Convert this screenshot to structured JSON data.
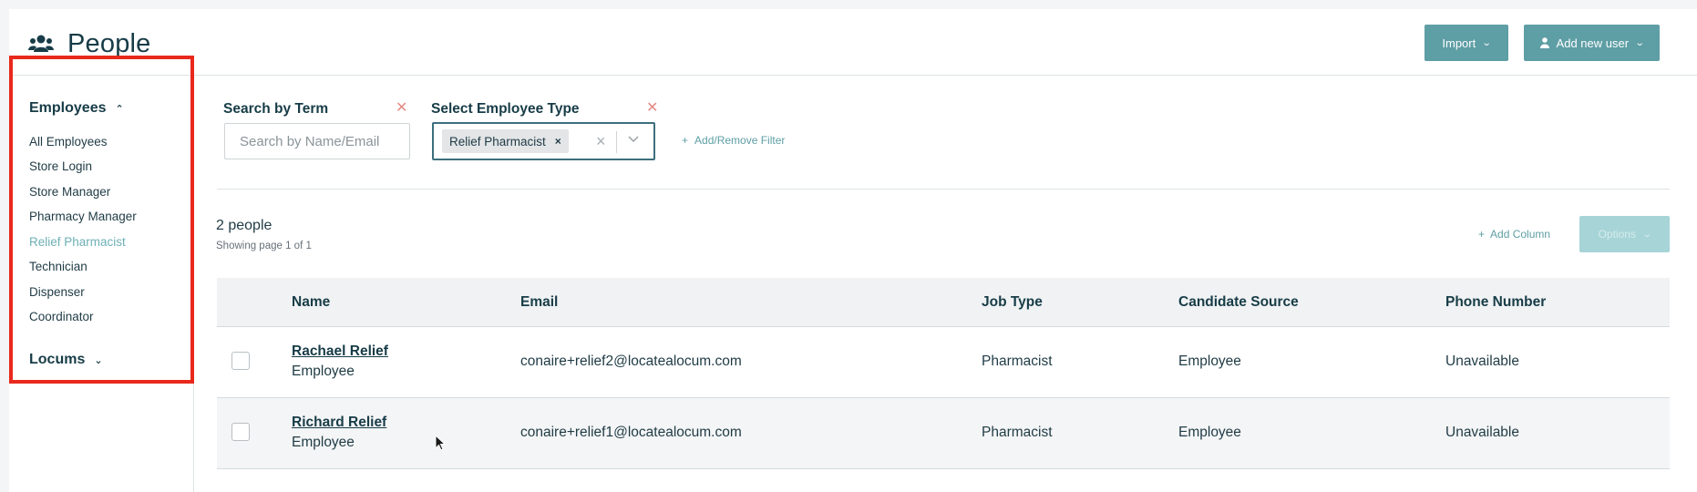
{
  "header": {
    "title": "People",
    "import_label": "Import",
    "add_user_label": "Add new user"
  },
  "sidebar": {
    "employees_label": "Employees",
    "items": [
      {
        "label": "All Employees"
      },
      {
        "label": "Store Login"
      },
      {
        "label": "Store Manager"
      },
      {
        "label": "Pharmacy Manager"
      },
      {
        "label": "Relief Pharmacist",
        "active": true
      },
      {
        "label": "Technician"
      },
      {
        "label": "Dispenser"
      },
      {
        "label": "Coordinator"
      }
    ],
    "locums_label": "Locums"
  },
  "filters": {
    "search_label": "Search by Term",
    "search_placeholder": "Search by Name/Email",
    "search_value": "",
    "type_label": "Select Employee Type",
    "selected_type": "Relief Pharmacist",
    "add_filter_label": "Add/Remove Filter"
  },
  "results": {
    "count": "2 people",
    "page_info": "Showing page 1 of 1",
    "add_column_label": "Add Column",
    "options_label": "Options"
  },
  "table": {
    "headers": [
      "Name",
      "Email",
      "Job Type",
      "Candidate Source",
      "Phone Number"
    ],
    "rows": [
      {
        "name": "Rachael Relief",
        "role": "Employee",
        "email": "conaire+relief2@locatealocum.com",
        "job_type": "Pharmacist",
        "source": "Employee",
        "phone": "Unavailable"
      },
      {
        "name": "Richard Relief",
        "role": "Employee",
        "email": "conaire+relief1@locatealocum.com",
        "job_type": "Pharmacist",
        "source": "Employee",
        "phone": "Unavailable"
      }
    ]
  },
  "colors": {
    "accent": "#5e9ea5",
    "active_link": "#6eb0b5",
    "highlight": "#e8291c",
    "clear": "#e58b85"
  }
}
